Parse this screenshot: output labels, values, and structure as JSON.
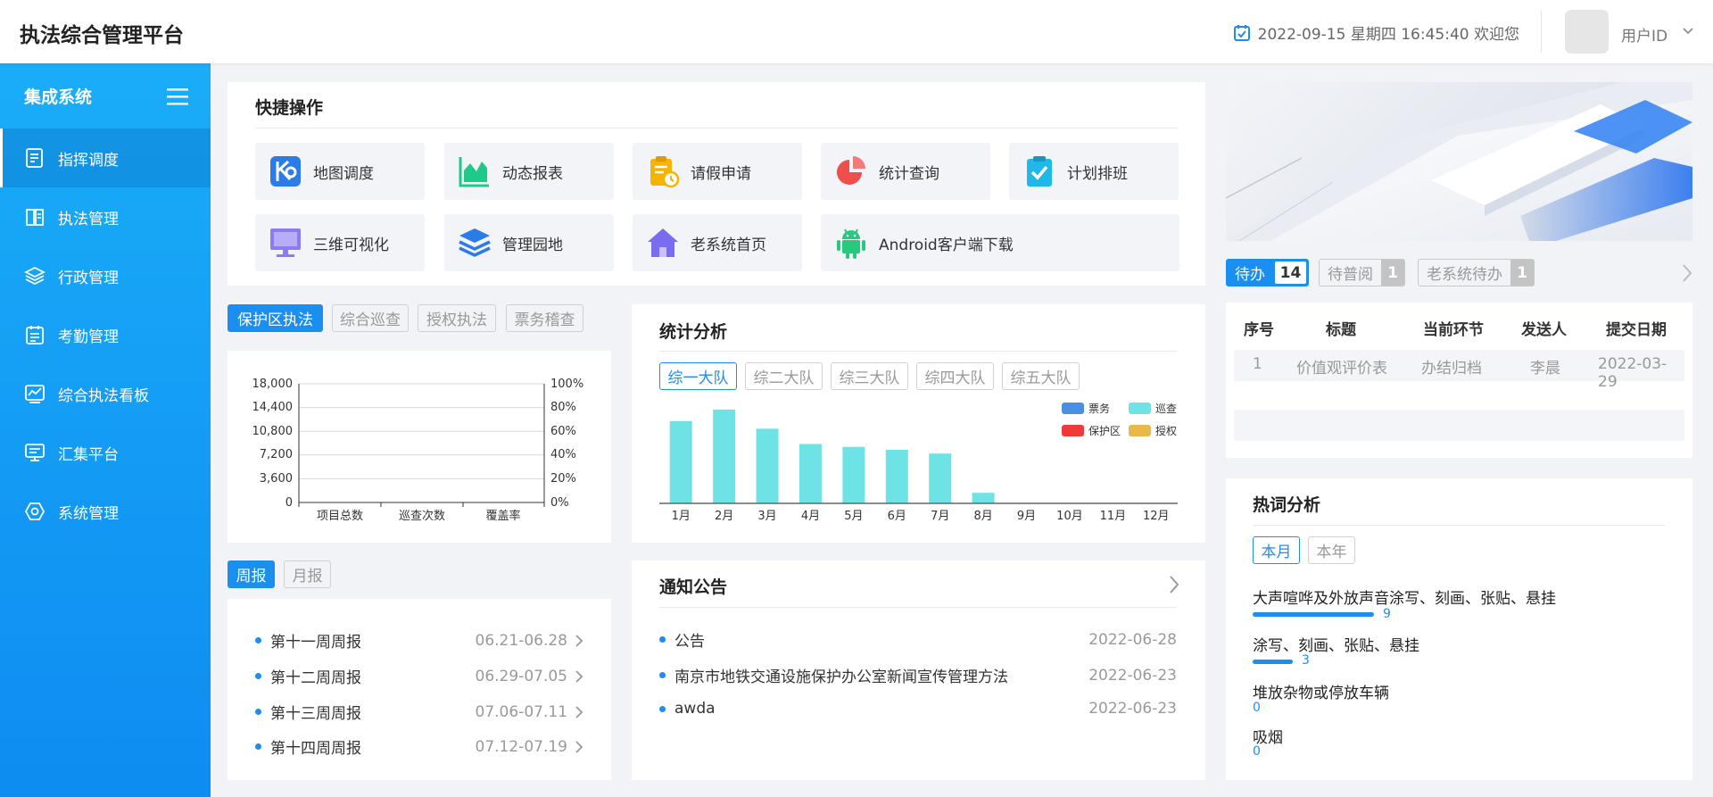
{
  "header": {
    "app_title": "执法综合管理平台",
    "datetime": "2022-09-15  星期四  16:45:40 欢迎您",
    "user_id": "用户ID"
  },
  "sidebar": {
    "title": "集成系统",
    "items": [
      {
        "label": "指挥调度",
        "icon": "dispatch-icon",
        "active": true
      },
      {
        "label": "执法管理",
        "icon": "book-icon"
      },
      {
        "label": "行政管理",
        "icon": "layers-icon"
      },
      {
        "label": "考勤管理",
        "icon": "calendar-icon"
      },
      {
        "label": "综合执法看板",
        "icon": "chart-board-icon"
      },
      {
        "label": "汇集平台",
        "icon": "monitor-icon"
      },
      {
        "label": "系统管理",
        "icon": "hexagon-gear-icon"
      }
    ]
  },
  "quick_ops": {
    "title": "快捷操作",
    "items": [
      {
        "label": "地图调度",
        "icon": "map-dispatch-icon",
        "color": "#2b7be8"
      },
      {
        "label": "动态报表",
        "icon": "area-chart-icon",
        "color": "#1ec98a"
      },
      {
        "label": "请假申请",
        "icon": "clipboard-clock-icon",
        "color": "#f5b400"
      },
      {
        "label": "统计查询",
        "icon": "pie-chart-icon",
        "color": "#f04d4d"
      },
      {
        "label": "计划排班",
        "icon": "clipboard-check-icon",
        "color": "#1fb8e8"
      },
      {
        "label": "三维可视化",
        "icon": "monitor-3d-icon",
        "color": "#8a7cf0"
      },
      {
        "label": "管理园地",
        "icon": "stack-icon",
        "color": "#2b7be8"
      },
      {
        "label": "老系统首页",
        "icon": "home-icon",
        "color": "#7a6cf0"
      },
      {
        "label": "Android客户端下载",
        "icon": "android-icon",
        "color": "#27c97d"
      }
    ]
  },
  "protect_tabs": [
    "保护区执法",
    "综合巡查",
    "授权执法",
    "票务稽查"
  ],
  "protect_chart": {
    "left_ticks": [
      "18,000",
      "14,400",
      "10,800",
      "7,200",
      "3,600",
      "0"
    ],
    "right_ticks": [
      "100%",
      "80%",
      "60%",
      "40%",
      "20%",
      "0%"
    ],
    "categories": [
      "项目总数",
      "巡查次数",
      "覆盖率"
    ]
  },
  "stats": {
    "title": "统计分析",
    "tabs": [
      "综一大队",
      "综二大队",
      "综三大队",
      "综四大队",
      "综五大队"
    ]
  },
  "chart_data": {
    "type": "bar",
    "categories": [
      "1月",
      "2月",
      "3月",
      "4月",
      "5月",
      "6月",
      "7月",
      "8月",
      "9月",
      "10月",
      "11月",
      "12月"
    ],
    "legend": [
      {
        "name": "票务",
        "color": "#4a90e2"
      },
      {
        "name": "巡查",
        "color": "#6ee3e6"
      },
      {
        "name": "保护区",
        "color": "#f03a3a"
      },
      {
        "name": "授权",
        "color": "#e8b84a"
      }
    ],
    "series": [
      {
        "name": "巡查",
        "values": [
          86,
          98,
          78,
          62,
          59,
          56,
          52,
          11,
          0,
          0,
          0,
          0
        ]
      }
    ],
    "ylim": [
      0,
      110
    ],
    "legend_position": "top-right",
    "grid": false
  },
  "reports": {
    "tabs": [
      "周报",
      "月报"
    ],
    "items": [
      {
        "title": "第十一周周报",
        "range": "06.21-06.28"
      },
      {
        "title": "第十二周周报",
        "range": "06.29-07.05"
      },
      {
        "title": "第十三周周报",
        "range": "07.06-07.11"
      },
      {
        "title": "第十四周周报",
        "range": "07.12-07.19"
      }
    ]
  },
  "notices": {
    "title": "通知公告",
    "items": [
      {
        "title": "公告",
        "date": "2022-06-28"
      },
      {
        "title": "南京市地铁交通设施保护办公室新闻宣传管理方法",
        "date": "2022-06-23"
      },
      {
        "title": "awda",
        "date": "2022-06-23"
      }
    ]
  },
  "todo": {
    "tabs": [
      {
        "label": "待办",
        "count": "14"
      },
      {
        "label": "待普阅",
        "count": "1"
      },
      {
        "label": "老系统待办",
        "count": "1"
      }
    ],
    "columns": [
      "序号",
      "标题",
      "当前环节",
      "发送人",
      "提交日期"
    ],
    "rows": [
      [
        "1",
        "价值观评价表",
        "办结归档",
        "李晨",
        "2022-03-29"
      ]
    ]
  },
  "hotwords": {
    "title": "热词分析",
    "tabs": [
      "本月",
      "本年"
    ],
    "items": [
      {
        "label": "大声喧哗及外放声音涂写、刻画、张贴、悬挂",
        "count": "9",
        "value": 9
      },
      {
        "label": "涂写、刻画、张贴、悬挂",
        "count": "3",
        "value": 3
      },
      {
        "label": "堆放杂物或停放车辆",
        "count": "0",
        "value": 0
      },
      {
        "label": "吸烟",
        "count": "0",
        "value": 0
      }
    ]
  }
}
